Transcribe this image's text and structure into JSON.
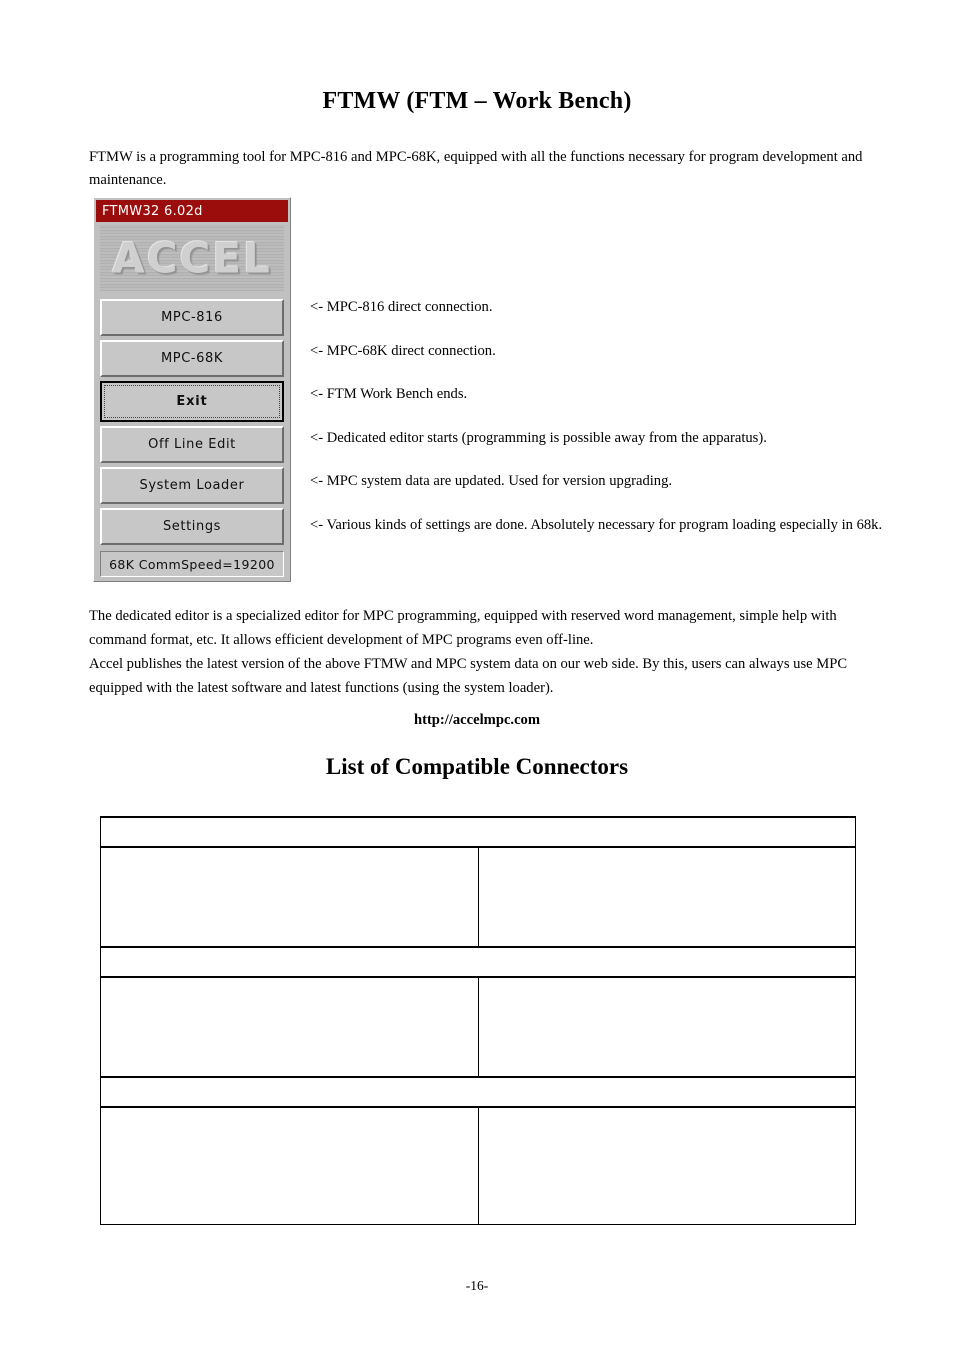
{
  "document": {
    "title": "FTMW (FTM – Work Bench)",
    "intro_paragraph": "FTMW is a programming tool for MPC-816 and MPC-68K, equipped with all the functions necessary for program development and maintenance.",
    "body_paragraph_1": "The dedicated editor is a specialized editor for MPC programming, equipped with reserved word management, simple help with command format, etc.  It allows efficient development of MPC programs even off-line.",
    "body_paragraph_2": "Accel publishes the latest version of the above FTMW and MPC system data on our web side.  By this, users can always use MPC equipped with the latest software and latest functions (using the system loader).",
    "web_url": "http://accelmpc.com",
    "section_title": "List of Compatible Connectors",
    "page_number": "-16-"
  },
  "app_window": {
    "titlebar": {
      "text": "FTMW32 6.02d",
      "background_color": "#9b0c0c",
      "text_color": "#ffffff"
    },
    "logo": {
      "wordmark": "ACCEL"
    },
    "buttons": [
      {
        "label": "MPC-816",
        "state": "normal"
      },
      {
        "label": "MPC-68K",
        "state": "normal"
      },
      {
        "label": "Exit",
        "state": "focused-default"
      },
      {
        "label": "Off Line Edit",
        "state": "normal"
      },
      {
        "label": "System Loader",
        "state": "normal"
      },
      {
        "label": "Settings",
        "state": "normal"
      }
    ],
    "statusbar": {
      "text": "68K CommSpeed=19200"
    },
    "face_color": "#c7c7c7"
  },
  "annotations": [
    {
      "text": "<- MPC-816 direct connection."
    },
    {
      "text": "<- MPC-68K direct connection."
    },
    {
      "text": "<- FTM Work Bench ends."
    },
    {
      "text": "<- Dedicated editor starts (programming is possible away from the apparatus)."
    },
    {
      "text": "<- MPC system data are updated.  Used for version upgrading."
    },
    {
      "text": "<- Various kinds of settings are done.  Absolutely necessary for program loading especially in 68k."
    }
  ],
  "connector_table": {
    "groups": [
      {
        "band": "",
        "left_cell": "",
        "right_cell": ""
      },
      {
        "band": "",
        "left_cell": "",
        "right_cell": ""
      },
      {
        "band": "",
        "left_cell": "",
        "right_cell": ""
      }
    ]
  }
}
